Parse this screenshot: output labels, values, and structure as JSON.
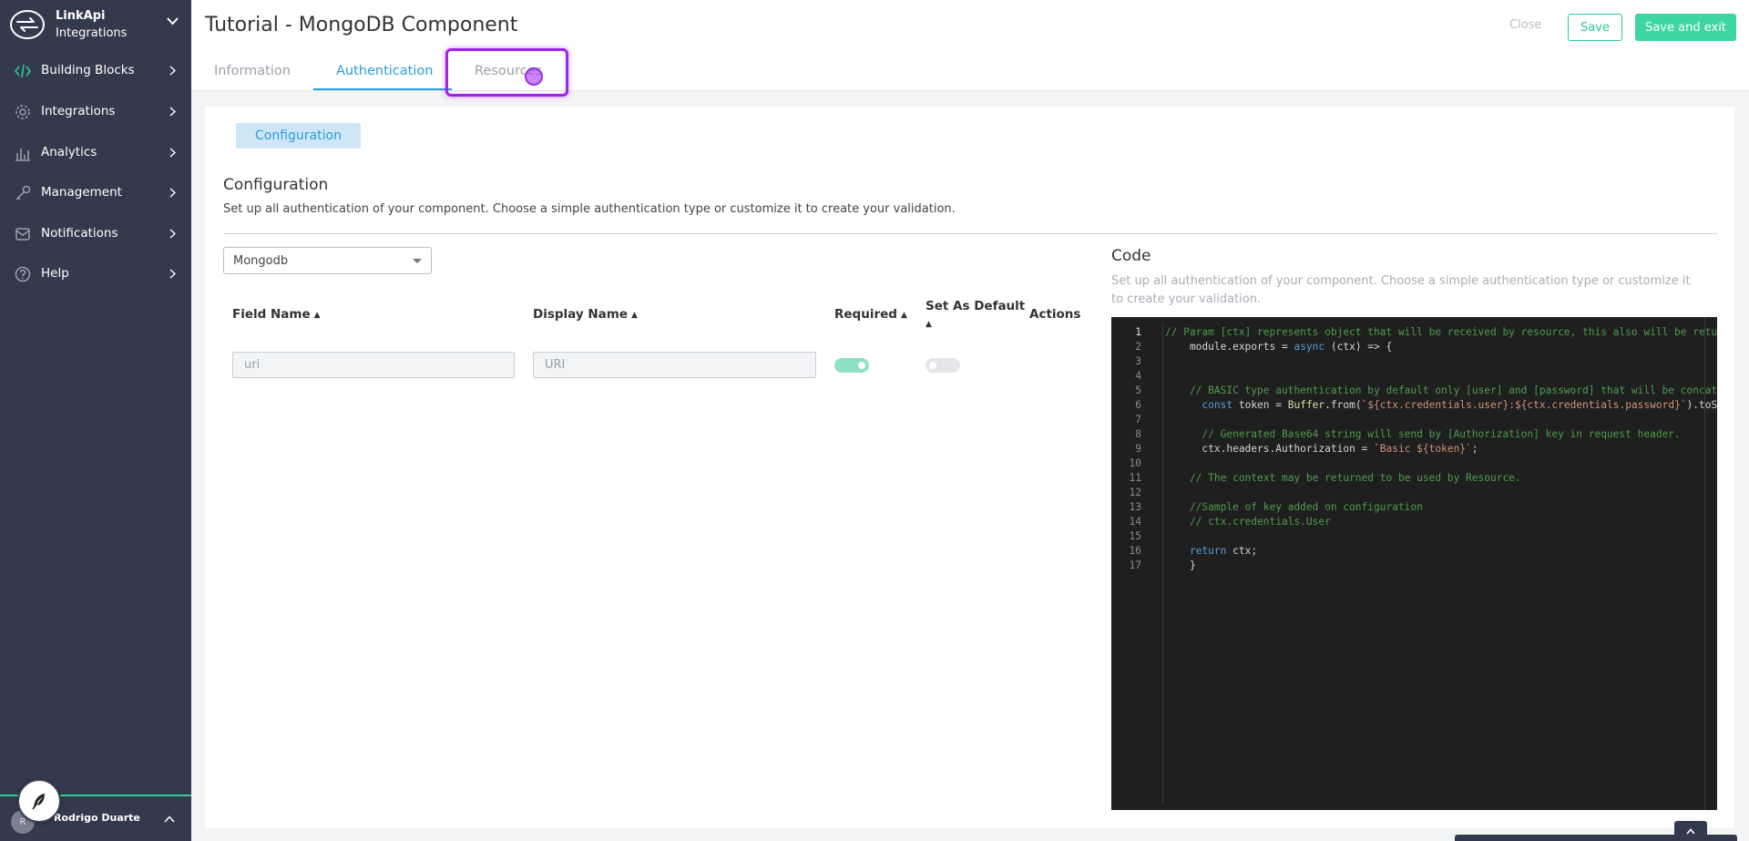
{
  "brand": {
    "name_bold": "LinkApi",
    "name_sub": "Integrations"
  },
  "sidebar": {
    "items": [
      {
        "label": "Building Blocks",
        "icon": "code-icon"
      },
      {
        "label": "Integrations",
        "icon": "gear-icon"
      },
      {
        "label": "Analytics",
        "icon": "bar-chart-icon"
      },
      {
        "label": "Management",
        "icon": "key-icon"
      },
      {
        "label": "Notifications",
        "icon": "bell-icon"
      },
      {
        "label": "Help",
        "icon": "question-icon"
      }
    ],
    "user": {
      "initials": "R",
      "name": "Rodrigo Duarte"
    }
  },
  "header": {
    "title": "Tutorial - MongoDB Component",
    "close_label": "Close",
    "save_label": "Save",
    "save_exit_label": "Save and exit",
    "tabs": [
      {
        "label": "Information",
        "active": false
      },
      {
        "label": "Authentication",
        "active": true
      },
      {
        "label": "Resources",
        "active": false
      }
    ]
  },
  "config": {
    "chip_label": "Configuration",
    "title": "Configuration",
    "description": "Set up all authentication of your component. Choose a simple authentication type or customize it to create your validation.",
    "selected_type": "Mongodb",
    "columns": {
      "field_name": "Field Name",
      "display_name": "Display Name",
      "required": "Required",
      "default_line1": "Set As Default",
      "actions": "Actions"
    },
    "row": {
      "field_name": "uri",
      "display_name": "URI",
      "required": true,
      "default": false
    }
  },
  "code": {
    "title": "Code",
    "description": "Set up all authentication of your component. Choose a simple authentication type or customize it to create your validation.",
    "lines": [
      "// Param [ctx] represents object that will be received by resource, this also will be returned",
      "    module.exports = async (ctx) => {",
      "",
      "",
      "    // BASIC type authentication by default only [user] and [password] that will be concatenated",
      "      const token = Buffer.from(`${ctx.credentials.user}:${ctx.credentials.password}`).toString",
      "",
      "      // Generated Base64 string will send by [Authorization] key in request header.",
      "      ctx.headers.Authorization = `Basic ${token}`;",
      "",
      "    // The context may be returned to be used by Resource.",
      "",
      "    //Sample of key added on configuration",
      "    // ctx.credentials.User",
      "",
      "    return ctx;",
      "    }"
    ]
  },
  "colors": {
    "accent": "#2ecc9a",
    "tab_active": "#2d9cdb",
    "sidebar_bg": "#343a4e",
    "highlight": "#a020f0"
  }
}
